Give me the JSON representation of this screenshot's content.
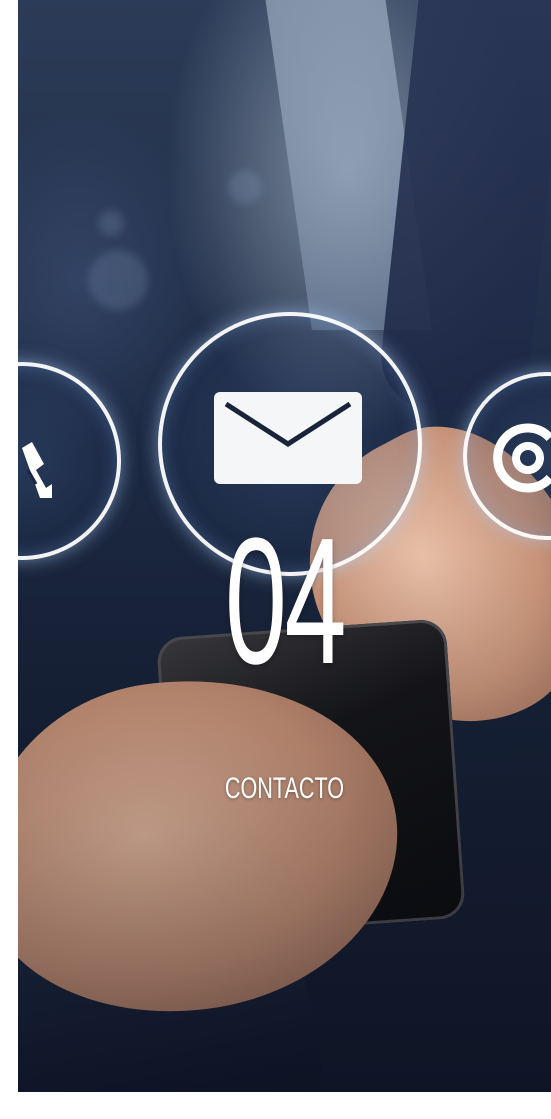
{
  "section": {
    "number": "04",
    "title": "CONTACTO"
  },
  "icons": [
    "phone-icon",
    "mail-icon",
    "at-sign-icon"
  ],
  "colors": {
    "text": "#ffffff",
    "background_navy": "#16223a",
    "holo_ring": "#ffffff"
  }
}
